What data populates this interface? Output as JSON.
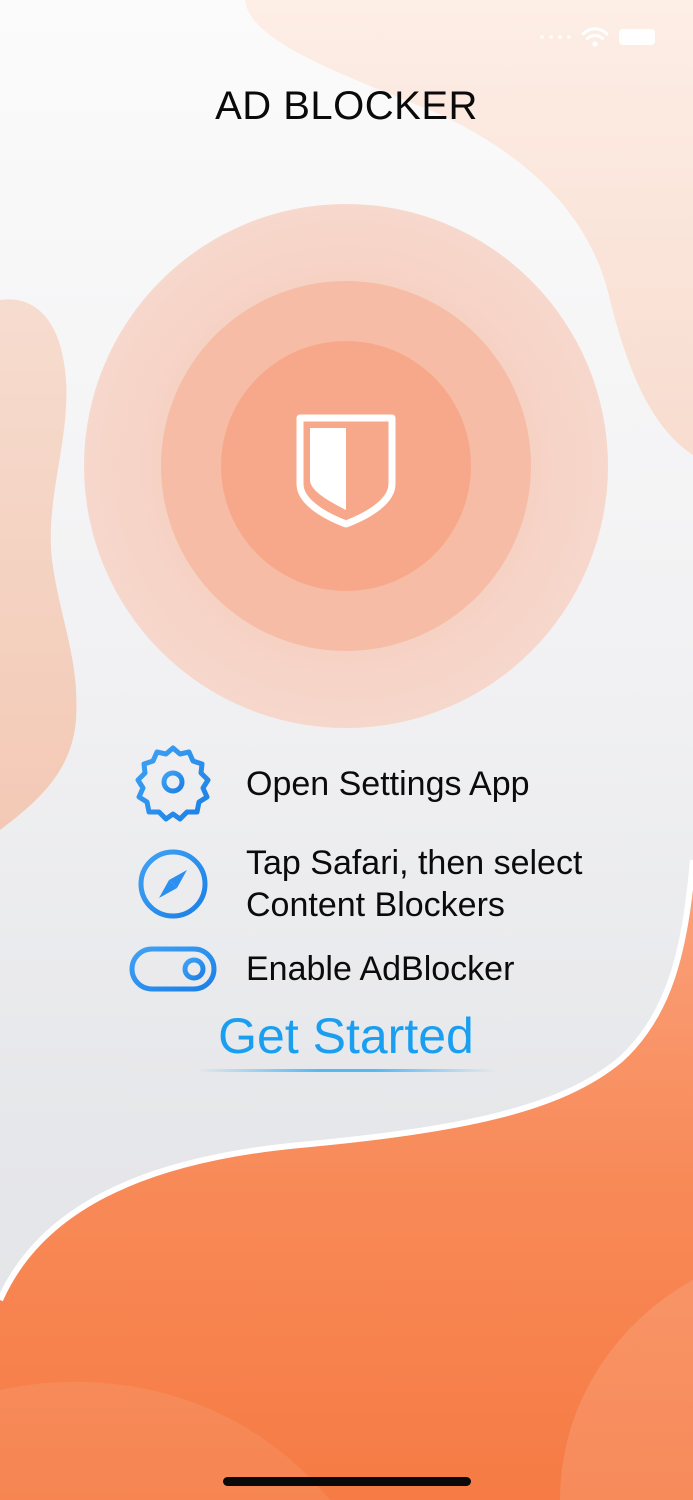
{
  "header": {
    "title": "AD BLOCKER"
  },
  "hero": {
    "icon": "shield-icon"
  },
  "steps": [
    {
      "icon": "gear-icon",
      "text_lines": [
        "Open Settings App"
      ]
    },
    {
      "icon": "safari-compass-icon",
      "text_lines": [
        "Tap Safari, then select",
        "Content Blockers"
      ]
    },
    {
      "icon": "toggle-switch-icon",
      "text_lines": [
        "Enable AdBlocker"
      ]
    }
  ],
  "cta": {
    "label": "Get Started"
  },
  "colors": {
    "accent_blue": "#1a9ff0",
    "icon_blue": "#2a8fee",
    "ring_outer": "#f6d1c3",
    "ring_middle": "#f5bba4",
    "ring_inner": "#f7a88b",
    "blob_orange": "#f7854f"
  }
}
